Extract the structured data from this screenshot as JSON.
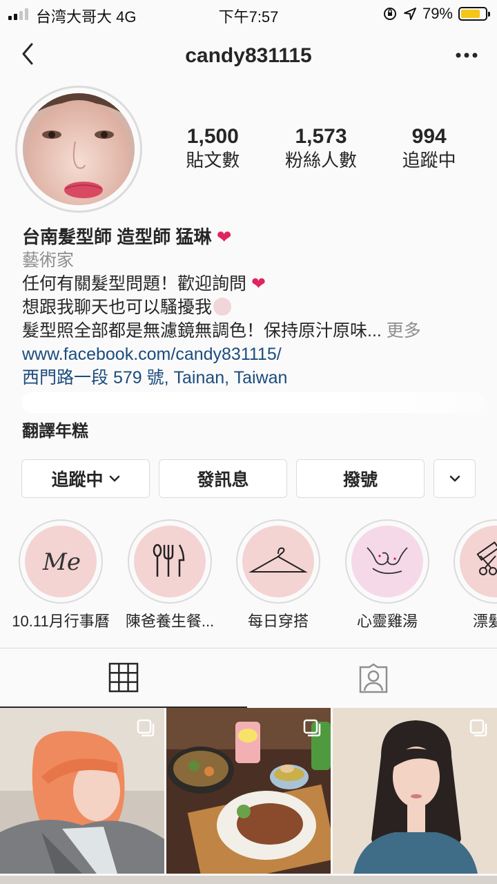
{
  "status_bar": {
    "carrier": "台湾大哥大 4G",
    "time": "下午7:57",
    "battery": "79%",
    "battery_level": 0.79
  },
  "header": {
    "username": "candy831115"
  },
  "stats": [
    {
      "value": "1,500",
      "label": "貼文數"
    },
    {
      "value": "1,573",
      "label": "粉絲人數"
    },
    {
      "value": "994",
      "label": "追蹤中"
    }
  ],
  "bio": {
    "name": "台南髮型師 造型師 猛琳",
    "category": "藝術家",
    "line1": "任何有關髮型問題！歡迎詢問",
    "line2": "想跟我聊天也可以騷擾我",
    "line3": "髮型照全部都是無濾鏡無調色！保持原汁原味...",
    "more": "更多",
    "website": "www.facebook.com/candy831115/",
    "address": "西門路一段 579 號, Tainan, Taiwan",
    "translate": "翻譯年糕"
  },
  "buttons": {
    "following": "追蹤中",
    "message": "發訊息",
    "call": "撥號"
  },
  "highlights": [
    {
      "label": "10.11月行事曆",
      "icon": "me-script-icon"
    },
    {
      "label": "陳爸養生餐...",
      "icon": "utensils-icon"
    },
    {
      "label": "每日穿搭",
      "icon": "hanger-icon"
    },
    {
      "label": "心靈雞湯",
      "icon": "pinky-promise-icon"
    },
    {
      "label": "漂髮特",
      "icon": "comb-scissors-icon"
    }
  ],
  "highlight_me_text": "Me",
  "tabs": [
    "grid-icon",
    "tagged-icon"
  ],
  "colors": {
    "link": "#1b4c7d",
    "muted": "#8e8e8e",
    "border": "#dbdbdb",
    "highlight_fill": "#f4d3d3"
  }
}
